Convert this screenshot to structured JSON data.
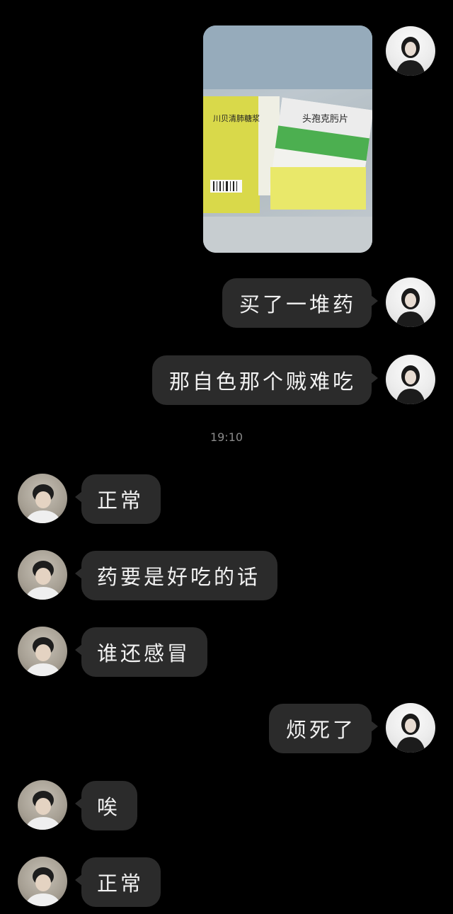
{
  "messages": [
    {
      "side": "me",
      "type": "image",
      "caption": "川贝清肺糖浆 / 头孢克肟片"
    },
    {
      "side": "me",
      "type": "text",
      "text": "买了一堆药"
    },
    {
      "side": "me",
      "type": "text",
      "text": "那自色那个贼难吃"
    },
    {
      "side": "peer",
      "type": "text",
      "text": "正常"
    },
    {
      "side": "peer",
      "type": "text",
      "text": "药要是好吃的话"
    },
    {
      "side": "peer",
      "type": "text",
      "text": "谁还感冒"
    },
    {
      "side": "me",
      "type": "text",
      "text": "烦死了"
    },
    {
      "side": "peer",
      "type": "text",
      "text": "唉"
    },
    {
      "side": "peer",
      "type": "text",
      "text": "正常"
    }
  ],
  "timestamp": "19:10",
  "photo": {
    "box1_label": "川贝清肺糖浆",
    "box2_label": "头孢克肟片"
  },
  "colors": {
    "background": "#000000",
    "bubble": "#2b2b2b",
    "text": "#f2f2f2",
    "timestamp": "#8a8a8a"
  }
}
